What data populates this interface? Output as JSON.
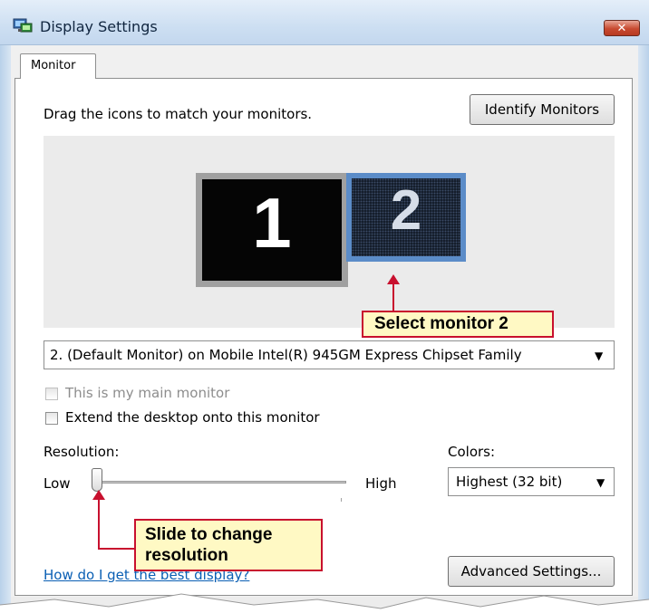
{
  "window": {
    "title": "Display Settings",
    "close_glyph": "✕",
    "app_icon": "display-settings-icon"
  },
  "tabs": [
    {
      "label": "Monitor",
      "selected": true
    }
  ],
  "monitor_tab": {
    "instruction": "Drag the icons to match your monitors.",
    "identify_button": "Identify Monitors",
    "monitors": [
      {
        "number": "1",
        "selected": false
      },
      {
        "number": "2",
        "selected": true
      }
    ],
    "monitor_select": {
      "value": "2. (Default Monitor) on Mobile Intel(R) 945GM Express Chipset Family"
    },
    "main_monitor_checkbox": {
      "label": "This is my main monitor",
      "checked": false,
      "enabled": false
    },
    "extend_checkbox": {
      "label": "Extend the desktop onto this monitor",
      "checked": false,
      "enabled": true
    },
    "resolution": {
      "label": "Resolution:",
      "low_label": "Low",
      "high_label": "High",
      "slider_level": 0
    },
    "colors": {
      "label": "Colors:",
      "value": "Highest (32 bit)"
    },
    "help_link": "How do I get the best display?",
    "advanced_button": "Advanced Settings..."
  },
  "annotations": {
    "select_monitor": "Select monitor 2",
    "slide_resolution_line1": "Slide to change",
    "slide_resolution_line2": "resolution"
  },
  "colors_theme": {
    "callout_border": "#c8102e",
    "callout_fill": "#fff9c4",
    "link": "#0a5fb4",
    "selected_monitor_border": "#5b8cc8"
  }
}
